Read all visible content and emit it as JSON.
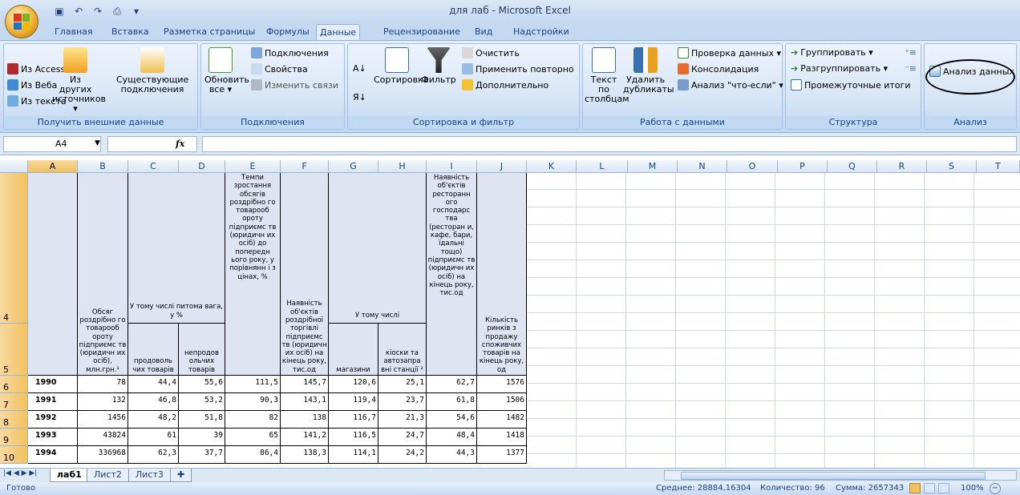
{
  "window": {
    "title": "для лаб - Microsoft Excel"
  },
  "tabs": [
    "Главная",
    "Вставка",
    "Разметка страницы",
    "Формулы",
    "Данные",
    "Рецензирование",
    "Вид",
    "Надстройки"
  ],
  "ribbon": {
    "get_external": {
      "access": "Из Access",
      "web": "Из Веба",
      "text": "Из текста",
      "other": "Из других источников ▾",
      "existing": "Существующие подключения",
      "label": "Получить внешние данные"
    },
    "connections": {
      "refresh": "Обновить все ▾",
      "connections": "Подключения",
      "properties": "Свойства",
      "edit_links": "Изменить связи",
      "label": "Подключения"
    },
    "sort_filter": {
      "sort": "Сортировка",
      "filter": "Фильтр",
      "clear": "Очистить",
      "reapply": "Применить повторно",
      "advanced": "Дополнительно",
      "label": "Сортировка и фильтр"
    },
    "data_tools": {
      "text_cols": "Текст по столбцам",
      "remove_dup": "Удалить дубликаты",
      "validation": "Проверка данных ▾",
      "consolidate": "Консолидация",
      "whatif": "Анализ \"что-если\" ▾",
      "label": "Работа с данными"
    },
    "outline": {
      "group": "Группировать ▾",
      "ungroup": "Разгруппировать ▾",
      "subtotal": "Промежуточные итоги",
      "label": "Структура"
    },
    "analysis": {
      "data_analysis": "Анализ данных",
      "label": "Анализ"
    }
  },
  "formula_bar": {
    "name_box": "A4",
    "fx": "fx",
    "value": ""
  },
  "columns": [
    "A",
    "B",
    "C",
    "D",
    "E",
    "F",
    "G",
    "H",
    "I",
    "J",
    "K",
    "L",
    "M",
    "N",
    "O",
    "P",
    "Q",
    "R",
    "S",
    "T"
  ],
  "rows": [
    "4",
    "5",
    "6",
    "7",
    "8",
    "9",
    "10"
  ],
  "headers": {
    "B": "Обсяг роздрібно го товарооб ороту підприємс тв (юридичн их осіб), млн.грн.¹",
    "CD": "У тому числі питома вага, у %",
    "C": "продоволь чих товарів",
    "D": "непродов ольчих товарів",
    "E": "Темпи зростання обсягів роздрібно го товарооб ороту підприємс тв (юридичн их осіб) до попередн ього року, у порівнянн і з цінах, %",
    "F": "Наявність об'єктів роздрібної торгівлі підприємс тв (юридичн их осіб) на кінець року, тис.од",
    "GH": "У тому числі",
    "G": "магазини",
    "H": "кіоски та автозапра вні станції ²",
    "I": "Наявність об'єктів ресторанн ого господарс тва (ресторан и, кафе, бари, їдальні тощо) підприємс тв (юридичн их осіб) на кінець року, тис.од",
    "J": "Кількість ринків з продажу споживчих товарів на кінець року, од"
  },
  "table": [
    {
      "year": "1990",
      "b": "78",
      "c": "44,4",
      "d": "55,6",
      "e": "111,5",
      "f": "145,7",
      "g": "120,6",
      "h": "25,1",
      "i": "62,7",
      "j": "1576"
    },
    {
      "year": "1991",
      "b": "132",
      "c": "46,8",
      "d": "53,2",
      "e": "90,3",
      "f": "143,1",
      "g": "119,4",
      "h": "23,7",
      "i": "61,8",
      "j": "1506"
    },
    {
      "year": "1992",
      "b": "1456",
      "c": "48,2",
      "d": "51,8",
      "e": "82",
      "f": "138",
      "g": "116,7",
      "h": "21,3",
      "i": "54,6",
      "j": "1482"
    },
    {
      "year": "1993",
      "b": "43824",
      "c": "61",
      "d": "39",
      "e": "65",
      "f": "141,2",
      "g": "116,5",
      "h": "24,7",
      "i": "48,4",
      "j": "1418"
    },
    {
      "year": "1994",
      "b": "336968",
      "c": "62,3",
      "d": "37,7",
      "e": "86,4",
      "f": "138,3",
      "g": "114,1",
      "h": "24,2",
      "i": "44,3",
      "j": "1377"
    }
  ],
  "sheets": [
    "лаб1",
    "Лист2",
    "Лист3"
  ],
  "status": {
    "ready": "Готово",
    "average": "Среднее: 28884,16304",
    "count": "Количество: 96",
    "sum": "Сумма: 2657343",
    "zoom": "100%"
  }
}
